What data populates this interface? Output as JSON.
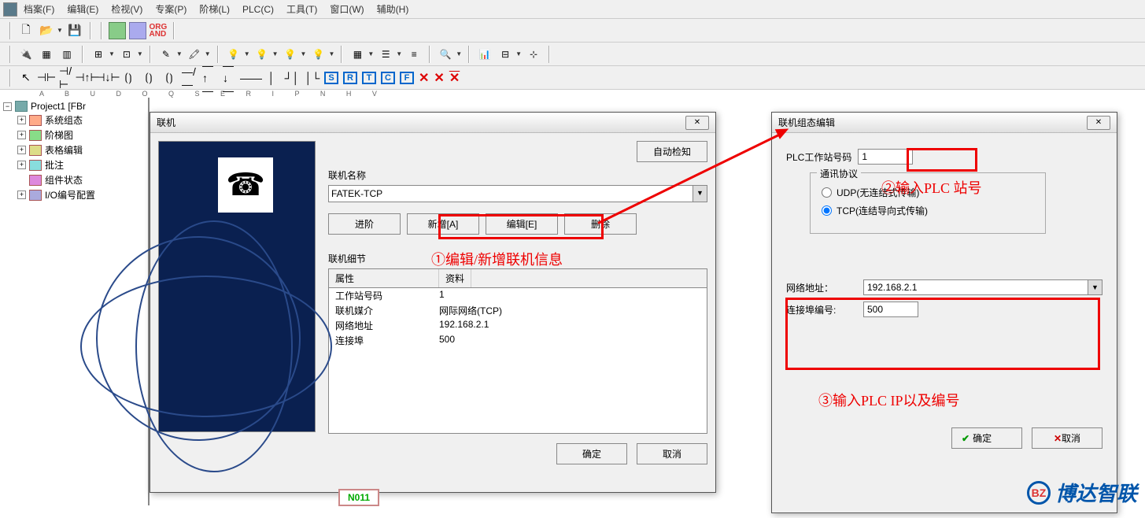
{
  "menubar": {
    "items": [
      "档案(F)",
      "编辑(E)",
      "检视(V)",
      "专案(P)",
      "阶梯(L)",
      "PLC(C)",
      "工具(T)",
      "窗口(W)",
      "辅助(H)"
    ]
  },
  "toolbar_org": "ORG\nAND",
  "tree": {
    "root": "Project1 [FBr",
    "children": [
      "系统组态",
      "阶梯图",
      "表格编辑",
      "批注",
      "组件状态",
      "I/O编号配置"
    ]
  },
  "dialog1": {
    "title": "联机",
    "auto_detect": "自动检知",
    "name_label": "联机名称",
    "name_value": "FATEK-TCP",
    "btn_advance": "进阶",
    "btn_add": "新增[A]",
    "btn_edit": "编辑[E]",
    "btn_delete": "删除",
    "detail_label": "联机细节",
    "col_attr": "属性",
    "col_data": "资料",
    "rows": [
      {
        "attr": "工作站号码",
        "data": "1"
      },
      {
        "attr": "联机媒介",
        "data": "网际网络(TCP)"
      },
      {
        "attr": "网络地址",
        "data": "192.168.2.1"
      },
      {
        "attr": "连接埠",
        "data": "500"
      }
    ],
    "ok": "确定",
    "cancel": "取消"
  },
  "dialog2": {
    "title": "联机组态编辑",
    "station_label": "PLC工作站号码",
    "station_value": "1",
    "protocol_label": "通讯协议",
    "udp_label": "UDP(无连结式传输)",
    "tcp_label": "TCP(连结导向式传输)",
    "addr_label": "网络地址：",
    "addr_value": "192.168.2.1",
    "port_label": "连接埠编号:",
    "port_value": "500",
    "ok": "确定",
    "cancel": "取消"
  },
  "annotations": {
    "a1": "①编辑/新增联机信息",
    "a2": "②输入PLC 站号",
    "a3": "③输入PLC IP以及编号"
  },
  "watermark": "博达智联",
  "bottom_cell": "N011"
}
